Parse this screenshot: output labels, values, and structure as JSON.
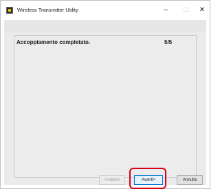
{
  "window": {
    "title": "Wireless Transmitter Utility",
    "controls": {
      "minimize": "–",
      "maximize": "□",
      "close": "✕"
    }
  },
  "content": {
    "heading": "Accoppiamento completato.",
    "step": "5/5"
  },
  "buttons": {
    "back": "<Indietro",
    "next": "Avanti>",
    "cancel": "Annulla"
  },
  "colors": {
    "highlight": "#d6001c",
    "accent": "#0078d7"
  },
  "icons": {
    "app": "wireless-utility-app-icon"
  }
}
